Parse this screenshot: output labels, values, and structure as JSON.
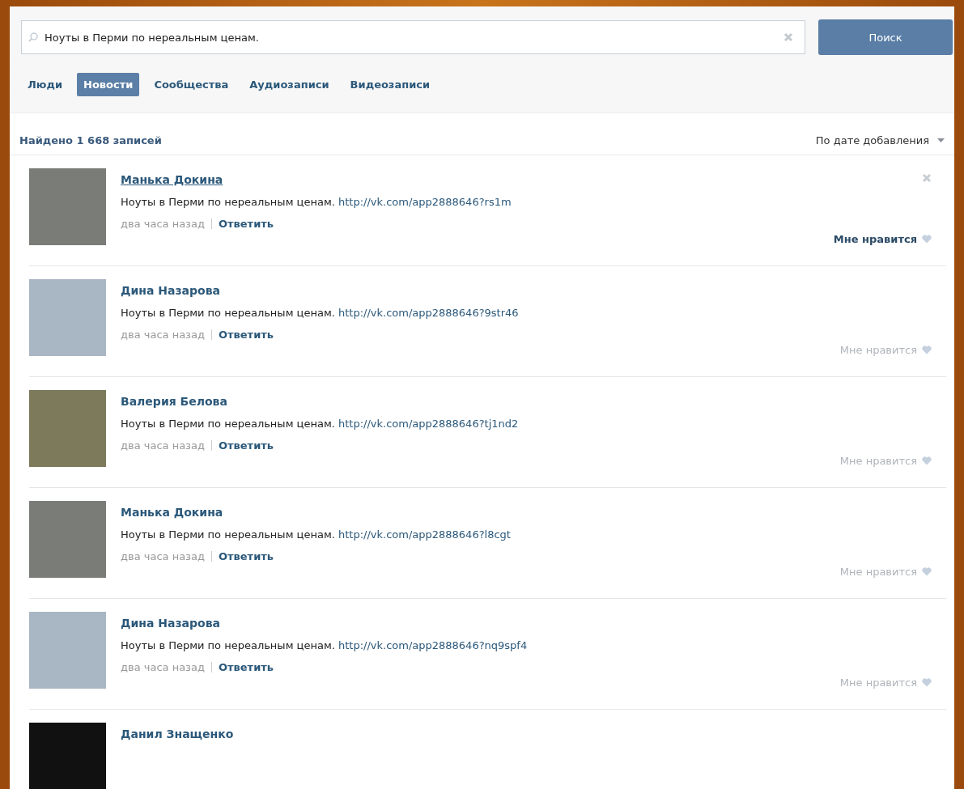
{
  "search": {
    "value": "Ноуты в Перми по нереальным ценам.",
    "button": "Поиск"
  },
  "tabs": [
    {
      "label": "Люди",
      "selected": false
    },
    {
      "label": "Новости",
      "selected": true
    },
    {
      "label": "Сообщества",
      "selected": false
    },
    {
      "label": "Аудиозаписи",
      "selected": false
    },
    {
      "label": "Видеозаписи",
      "selected": false
    }
  ],
  "results": {
    "count": "Найдено 1 668 записей",
    "sort": "По дате добавления"
  },
  "posts": [
    {
      "author": "Манька Докина",
      "text": "Ноуты в Перми по нереальным ценам.",
      "link": "http://vk.com/app2888646?rs1m",
      "time": "два часа назад",
      "reply": "Ответить",
      "like": "Мне нравится",
      "hovered": true
    },
    {
      "author": "Дина Назарова",
      "text": "Ноуты в Перми по нереальным ценам.",
      "link": "http://vk.com/app2888646?9str46",
      "time": "два часа назад",
      "reply": "Ответить",
      "like": "Мне нравится",
      "hovered": false
    },
    {
      "author": "Валерия Белова",
      "text": "Ноуты в Перми по нереальным ценам.",
      "link": "http://vk.com/app2888646?tj1nd2",
      "time": "два часа назад",
      "reply": "Ответить",
      "like": "Мне нравится",
      "hovered": false
    },
    {
      "author": "Манька Докина",
      "text": "Ноуты в Перми по нереальным ценам.",
      "link": "http://vk.com/app2888646?l8cgt",
      "time": "два часа назад",
      "reply": "Ответить",
      "like": "Мне нравится",
      "hovered": false
    },
    {
      "author": "Дина Назарова",
      "text": "Ноуты в Перми по нереальным ценам.",
      "link": "http://vk.com/app2888646?nq9spf4",
      "time": "два часа назад",
      "reply": "Ответить",
      "like": "Мне нравится",
      "hovered": false
    },
    {
      "author": "Данил Знащенко",
      "hovered": false
    }
  ]
}
